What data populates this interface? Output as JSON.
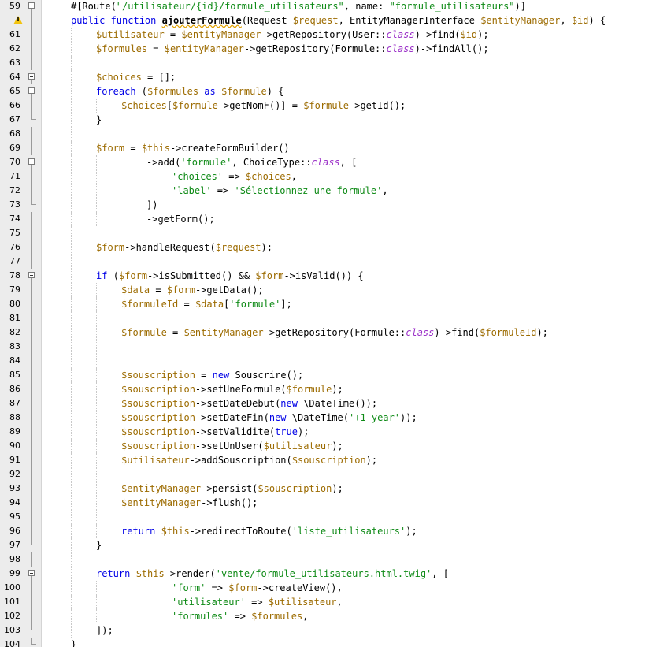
{
  "colors": {
    "keyword": "#0000e6",
    "variable": "#9c6b00",
    "string": "#0e8a16",
    "class_keyword": "#9b30c8",
    "plain": "#000000",
    "gutter_bg": "#ececec",
    "warning": "#f2c30f"
  },
  "icons": {
    "warning": "warning-icon",
    "fold": "fold-toggle-icon"
  },
  "lines": [
    {
      "n": "59",
      "indent": 1,
      "fold": "open",
      "tokens": [
        [
          "p",
          "#[Route("
        ],
        [
          "s",
          "\"/utilisateur/{id}/formule_utilisateurs\""
        ],
        [
          "p",
          ", name: "
        ],
        [
          "s",
          "\"formule_utilisateurs\""
        ],
        [
          "p",
          ")]"
        ]
      ]
    },
    {
      "n": "",
      "indent": 1,
      "fold": "line",
      "warning": true,
      "tokens": [
        [
          "k",
          "public function "
        ],
        [
          "fb",
          "ajouterFormule"
        ],
        [
          "p",
          "(Request "
        ],
        [
          "v",
          "$request"
        ],
        [
          "p",
          ", EntityManagerInterface "
        ],
        [
          "v",
          "$entityManager"
        ],
        [
          "p",
          ", "
        ],
        [
          "v",
          "$id"
        ],
        [
          "p",
          ") {"
        ]
      ]
    },
    {
      "n": "61",
      "indent": 2,
      "fold": "line",
      "tokens": [
        [
          "v",
          "$utilisateur"
        ],
        [
          "p",
          " = "
        ],
        [
          "v",
          "$entityManager"
        ],
        [
          "p",
          "->getRepository(User::"
        ],
        [
          "c",
          "class"
        ],
        [
          "p",
          ")->find("
        ],
        [
          "v",
          "$id"
        ],
        [
          "p",
          ");"
        ]
      ]
    },
    {
      "n": "62",
      "indent": 2,
      "fold": "line",
      "tokens": [
        [
          "v",
          "$formules"
        ],
        [
          "p",
          " = "
        ],
        [
          "v",
          "$entityManager"
        ],
        [
          "p",
          "->getRepository(Formule::"
        ],
        [
          "c",
          "class"
        ],
        [
          "p",
          ")->findAll();"
        ]
      ]
    },
    {
      "n": "63",
      "indent": 2,
      "fold": "line",
      "tokens": []
    },
    {
      "n": "64",
      "indent": 2,
      "fold": "open",
      "tokens": [
        [
          "v",
          "$choices"
        ],
        [
          "p",
          " = [];"
        ]
      ]
    },
    {
      "n": "65",
      "indent": 2,
      "fold": "open",
      "tokens": [
        [
          "k",
          "foreach "
        ],
        [
          "p",
          "("
        ],
        [
          "v",
          "$formules"
        ],
        [
          "k",
          " as "
        ],
        [
          "v",
          "$formule"
        ],
        [
          "p",
          ") {"
        ]
      ]
    },
    {
      "n": "66",
      "indent": 3,
      "fold": "line",
      "tokens": [
        [
          "v",
          "$choices"
        ],
        [
          "p",
          "["
        ],
        [
          "v",
          "$formule"
        ],
        [
          "p",
          "->getNomF()] = "
        ],
        [
          "v",
          "$formule"
        ],
        [
          "p",
          "->getId();"
        ]
      ]
    },
    {
      "n": "67",
      "indent": 2,
      "fold": "end",
      "tokens": [
        [
          "p",
          "}"
        ]
      ]
    },
    {
      "n": "68",
      "indent": 2,
      "fold": "line",
      "tokens": []
    },
    {
      "n": "69",
      "indent": 2,
      "fold": "line",
      "tokens": [
        [
          "v",
          "$form"
        ],
        [
          "p",
          " = "
        ],
        [
          "v",
          "$this"
        ],
        [
          "p",
          "->createFormBuilder()"
        ]
      ]
    },
    {
      "n": "70",
      "indent": 4,
      "fold": "open",
      "tokens": [
        [
          "p",
          "->add("
        ],
        [
          "s",
          "'formule'"
        ],
        [
          "p",
          ", ChoiceType::"
        ],
        [
          "c",
          "class"
        ],
        [
          "p",
          ", ["
        ]
      ]
    },
    {
      "n": "71",
      "indent": 5,
      "fold": "line",
      "tokens": [
        [
          "s",
          "'choices'"
        ],
        [
          "p",
          " => "
        ],
        [
          "v",
          "$choices"
        ],
        [
          "p",
          ","
        ]
      ]
    },
    {
      "n": "72",
      "indent": 5,
      "fold": "line",
      "tokens": [
        [
          "s",
          "'label'"
        ],
        [
          "p",
          " => "
        ],
        [
          "s",
          "'Sélectionnez une formule'"
        ],
        [
          "p",
          ","
        ]
      ]
    },
    {
      "n": "73",
      "indent": 4,
      "fold": "end",
      "tokens": [
        [
          "p",
          "])"
        ]
      ]
    },
    {
      "n": "74",
      "indent": 4,
      "fold": "line",
      "tokens": [
        [
          "p",
          "->getForm();"
        ]
      ]
    },
    {
      "n": "75",
      "indent": 2,
      "fold": "line",
      "tokens": []
    },
    {
      "n": "76",
      "indent": 2,
      "fold": "line",
      "tokens": [
        [
          "v",
          "$form"
        ],
        [
          "p",
          "->handleRequest("
        ],
        [
          "v",
          "$request"
        ],
        [
          "p",
          ");"
        ]
      ]
    },
    {
      "n": "77",
      "indent": 2,
      "fold": "line",
      "tokens": []
    },
    {
      "n": "78",
      "indent": 2,
      "fold": "open",
      "tokens": [
        [
          "k",
          "if "
        ],
        [
          "p",
          "("
        ],
        [
          "v",
          "$form"
        ],
        [
          "p",
          "->isSubmitted() && "
        ],
        [
          "v",
          "$form"
        ],
        [
          "p",
          "->isValid()) {"
        ]
      ]
    },
    {
      "n": "79",
      "indent": 3,
      "fold": "line",
      "tokens": [
        [
          "v",
          "$data"
        ],
        [
          "p",
          " = "
        ],
        [
          "v",
          "$form"
        ],
        [
          "p",
          "->getData();"
        ]
      ]
    },
    {
      "n": "80",
      "indent": 3,
      "fold": "line",
      "tokens": [
        [
          "v",
          "$formuleId"
        ],
        [
          "p",
          " = "
        ],
        [
          "v",
          "$data"
        ],
        [
          "p",
          "["
        ],
        [
          "s",
          "'formule'"
        ],
        [
          "p",
          "];"
        ]
      ]
    },
    {
      "n": "81",
      "indent": 3,
      "fold": "line",
      "tokens": []
    },
    {
      "n": "82",
      "indent": 3,
      "fold": "line",
      "tokens": [
        [
          "v",
          "$formule"
        ],
        [
          "p",
          " = "
        ],
        [
          "v",
          "$entityManager"
        ],
        [
          "p",
          "->getRepository(Formule::"
        ],
        [
          "c",
          "class"
        ],
        [
          "p",
          ")->find("
        ],
        [
          "v",
          "$formuleId"
        ],
        [
          "p",
          ");"
        ]
      ]
    },
    {
      "n": "83",
      "indent": 3,
      "fold": "line",
      "tokens": []
    },
    {
      "n": "84",
      "indent": 3,
      "fold": "line",
      "tokens": []
    },
    {
      "n": "85",
      "indent": 3,
      "fold": "line",
      "tokens": [
        [
          "v",
          "$souscription"
        ],
        [
          "p",
          " = "
        ],
        [
          "k",
          "new "
        ],
        [
          "p",
          "Souscrire();"
        ]
      ]
    },
    {
      "n": "86",
      "indent": 3,
      "fold": "line",
      "tokens": [
        [
          "v",
          "$souscription"
        ],
        [
          "p",
          "->setUneFormule("
        ],
        [
          "v",
          "$formule"
        ],
        [
          "p",
          ");"
        ]
      ]
    },
    {
      "n": "87",
      "indent": 3,
      "fold": "line",
      "tokens": [
        [
          "v",
          "$souscription"
        ],
        [
          "p",
          "->setDateDebut("
        ],
        [
          "k",
          "new "
        ],
        [
          "p",
          "\\DateTime());"
        ]
      ]
    },
    {
      "n": "88",
      "indent": 3,
      "fold": "line",
      "tokens": [
        [
          "v",
          "$souscription"
        ],
        [
          "p",
          "->setDateFin("
        ],
        [
          "k",
          "new "
        ],
        [
          "p",
          "\\DateTime("
        ],
        [
          "s",
          "'+1 year'"
        ],
        [
          "p",
          "));"
        ]
      ]
    },
    {
      "n": "89",
      "indent": 3,
      "fold": "line",
      "tokens": [
        [
          "v",
          "$souscription"
        ],
        [
          "p",
          "->setValidite("
        ],
        [
          "k",
          "true"
        ],
        [
          "p",
          ");"
        ]
      ]
    },
    {
      "n": "90",
      "indent": 3,
      "fold": "line",
      "tokens": [
        [
          "v",
          "$souscription"
        ],
        [
          "p",
          "->setUnUser("
        ],
        [
          "v",
          "$utilisateur"
        ],
        [
          "p",
          ");"
        ]
      ]
    },
    {
      "n": "91",
      "indent": 3,
      "fold": "line",
      "tokens": [
        [
          "v",
          "$utilisateur"
        ],
        [
          "p",
          "->addSouscription("
        ],
        [
          "v",
          "$souscription"
        ],
        [
          "p",
          ");"
        ]
      ]
    },
    {
      "n": "92",
      "indent": 3,
      "fold": "line",
      "tokens": []
    },
    {
      "n": "93",
      "indent": 3,
      "fold": "line",
      "tokens": [
        [
          "v",
          "$entityManager"
        ],
        [
          "p",
          "->persist("
        ],
        [
          "v",
          "$souscription"
        ],
        [
          "p",
          ");"
        ]
      ]
    },
    {
      "n": "94",
      "indent": 3,
      "fold": "line",
      "tokens": [
        [
          "v",
          "$entityManager"
        ],
        [
          "p",
          "->flush();"
        ]
      ]
    },
    {
      "n": "95",
      "indent": 3,
      "fold": "line",
      "tokens": []
    },
    {
      "n": "96",
      "indent": 3,
      "fold": "line",
      "tokens": [
        [
          "k",
          "return "
        ],
        [
          "v",
          "$this"
        ],
        [
          "p",
          "->redirectToRoute("
        ],
        [
          "s",
          "'liste_utilisateurs'"
        ],
        [
          "p",
          ");"
        ]
      ]
    },
    {
      "n": "97",
      "indent": 2,
      "fold": "end",
      "tokens": [
        [
          "p",
          "}"
        ]
      ]
    },
    {
      "n": "98",
      "indent": 2,
      "fold": "line",
      "tokens": []
    },
    {
      "n": "99",
      "indent": 2,
      "fold": "open",
      "tokens": [
        [
          "k",
          "return "
        ],
        [
          "v",
          "$this"
        ],
        [
          "p",
          "->render("
        ],
        [
          "s",
          "'vente/formule_utilisateurs.html.twig'"
        ],
        [
          "p",
          ", ["
        ]
      ]
    },
    {
      "n": "100",
      "indent": 5,
      "fold": "line",
      "tokens": [
        [
          "s",
          "'form'"
        ],
        [
          "p",
          " => "
        ],
        [
          "v",
          "$form"
        ],
        [
          "p",
          "->createView(),"
        ]
      ]
    },
    {
      "n": "101",
      "indent": 5,
      "fold": "line",
      "tokens": [
        [
          "s",
          "'utilisateur'"
        ],
        [
          "p",
          " => "
        ],
        [
          "v",
          "$utilisateur"
        ],
        [
          "p",
          ","
        ]
      ]
    },
    {
      "n": "102",
      "indent": 5,
      "fold": "line",
      "tokens": [
        [
          "s",
          "'formules'"
        ],
        [
          "p",
          " => "
        ],
        [
          "v",
          "$formules"
        ],
        [
          "p",
          ","
        ]
      ]
    },
    {
      "n": "103",
      "indent": 2,
      "fold": "end",
      "tokens": [
        [
          "p",
          "]);"
        ]
      ]
    },
    {
      "n": "104",
      "indent": 1,
      "fold": "end",
      "tokens": [
        [
          "p",
          "}"
        ]
      ]
    }
  ]
}
